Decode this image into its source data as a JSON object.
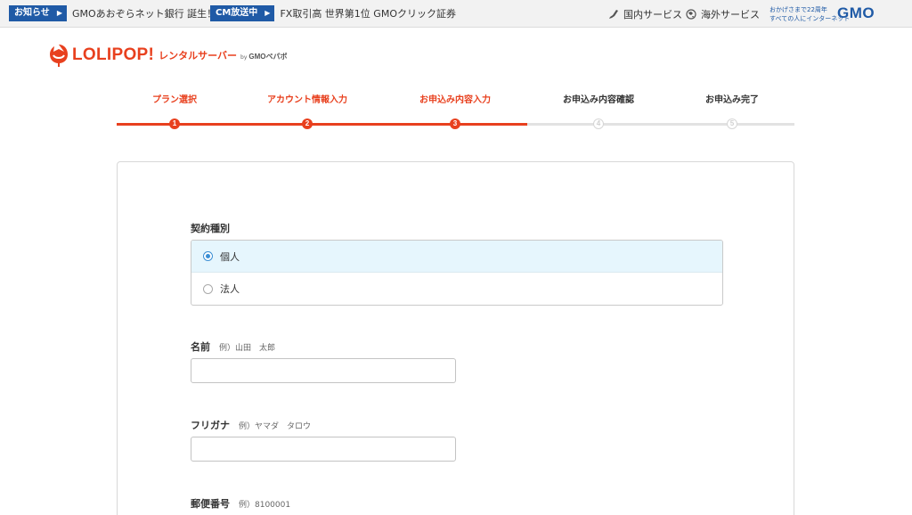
{
  "gmo_bar": {
    "news": [
      {
        "badge": "お知らせ",
        "text": "GMOあおぞらネット銀行 誕生！"
      },
      {
        "badge": "CM放送中",
        "text": "FX取引高 世界第1位 GMOクリック証券"
      }
    ],
    "links": {
      "domestic": "国内サービス",
      "overseas": "海外サービス"
    },
    "slogan_line1": "おかげさまで22周年",
    "slogan_line2": "すべての人にインターネット",
    "logo_text": "GMO"
  },
  "header": {
    "logo_word": "LOLIPOP!",
    "logo_sub": "レンタルサーバー",
    "logo_by": "by",
    "logo_gmo": "GMOペパボ"
  },
  "stepper": {
    "steps": [
      {
        "label": "プラン選択",
        "num": "1",
        "state": "done"
      },
      {
        "label": "アカウント情報入力",
        "num": "2",
        "state": "done"
      },
      {
        "label": "お申込み内容入力",
        "num": "3",
        "state": "current"
      },
      {
        "label": "お申込み内容確認",
        "num": "4",
        "state": "todo"
      },
      {
        "label": "お申込み完了",
        "num": "5",
        "state": "todo"
      }
    ]
  },
  "form": {
    "contract_type": {
      "label": "契約種別",
      "options": [
        {
          "label": "個人",
          "selected": true
        },
        {
          "label": "法人",
          "selected": false
        }
      ]
    },
    "name": {
      "label": "名前",
      "example": "例）山田　太郎",
      "value": ""
    },
    "furigana": {
      "label": "フリガナ",
      "example": "例）ヤマダ　タロウ",
      "value": ""
    },
    "postal": {
      "label": "郵便番号",
      "example": "例）8100001",
      "value": ""
    }
  },
  "colors": {
    "brand": "#e8401e",
    "gmo_blue": "#1f5aa6",
    "radio_selected_bg": "#e6f6fd"
  }
}
